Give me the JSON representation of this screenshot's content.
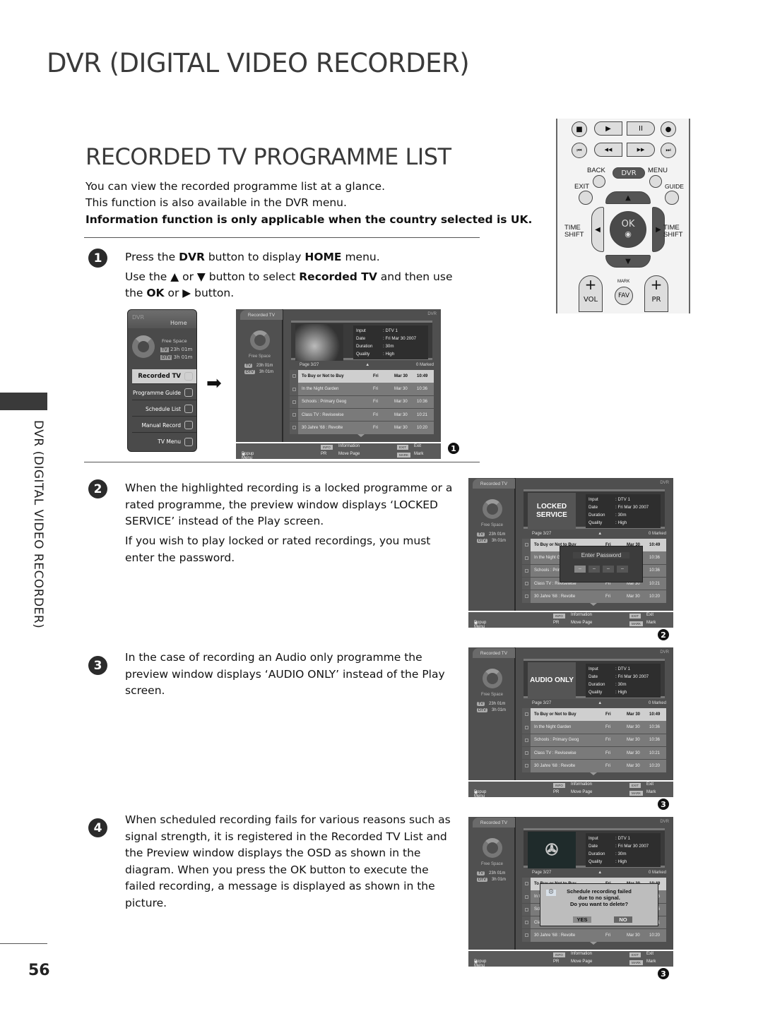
{
  "page": {
    "section_title": "DVR (DIGITAL VIDEO RECORDER)",
    "title": "RECORDED TV PROGRAMME LIST",
    "side_label": "DVR (DIGITAL VIDEO RECORDER)",
    "page_number": "56",
    "intro": [
      "You can view the recorded programme list at a glance.",
      "This function is also available in the DVR menu.",
      "Information function is only applicable when the country selected is UK."
    ]
  },
  "steps": [
    {
      "number": "1",
      "lines": {
        "a_pre": "Press the ",
        "a_b1": "DVR",
        "a_mid": " button to display ",
        "a_b2": "HOME",
        "a_post": " menu.",
        "b_pre": "Use the ▲ or ▼ button to select ",
        "b_b1": "Recorded TV",
        "b_post": " and then use",
        "c_pre": "the ",
        "c_b1": "OK",
        "c_post": " or ▶ button."
      }
    },
    {
      "number": "2",
      "text1": "When the highlighted recording is a locked programme or a rated programme, the preview window displays ‘LOCKED SERVICE’ instead of the Play screen.",
      "text2": "If you wish to play locked or rated recordings, you must enter the password."
    },
    {
      "number": "3",
      "text1": "In the case of recording an Audio only programme the preview window displays ‘AUDIO ONLY’ instead of the Play screen."
    },
    {
      "number": "4",
      "text1": "When scheduled recording fails for various reasons such as signal strength, it is registered in the Recorded TV List and the Preview window displays the OSD as shown in the diagram. When you press the OK button to execute the failed recording, a message is displayed as shown in the picture."
    }
  ],
  "remote": {
    "row1": [
      "■",
      "▶",
      "II",
      "●"
    ],
    "row2": [
      "⏮",
      "◀◀",
      "▶▶",
      "⏭"
    ],
    "back": "BACK",
    "dvr": "DVR",
    "menu": "MENU",
    "exit": "EXIT",
    "guide": "GUIDE",
    "time_shift_left": "TIME SHIFT",
    "time_shift_right": "TIME SHIFT",
    "ok": "OK",
    "mark": "MARK",
    "fav": "FAV",
    "vol": "VOL",
    "pr": "PR",
    "plus": "+"
  },
  "home_menu": {
    "logo": "DVR",
    "title": "Home",
    "free_space": "Free Space",
    "tv_badge": "TV",
    "tv_time": "23h 01m",
    "dtv_badge": "DTV",
    "dtv_time": "3h 01m",
    "items": [
      "Recorded TV",
      "Programme Guide",
      "Schedule List",
      "Manual Record",
      "TV Menu"
    ],
    "selected": "Recorded TV"
  },
  "recorded_tv": {
    "tab": "Recorded TV",
    "logo": "DVR",
    "free_space": "Free Space",
    "tv_badge": "TV",
    "tv_time": "23h 01m",
    "dtv_badge": "DTV",
    "dtv_time": "3h 01m",
    "info": [
      {
        "label": "Input",
        "value": ": DTV 1"
      },
      {
        "label": "Date",
        "value": ": Fri Mar 30 2007"
      },
      {
        "label": "Duration",
        "value": ": 30m"
      },
      {
        "label": "Quality",
        "value": ": High"
      }
    ],
    "page": "Page   3/27",
    "marked": "0 Marked",
    "rows": [
      {
        "title": "To Buy or Not to Buy",
        "day": "Fri",
        "date": "Mar 30",
        "time": "10:49"
      },
      {
        "title": "In the Night Garden",
        "day": "Fri",
        "date": "Mar 30",
        "time": "10:36"
      },
      {
        "title": "Schools : Primary Geog",
        "day": "Fri",
        "date": "Mar 30",
        "time": "10:36"
      },
      {
        "title": "Class TV : Revisewise",
        "day": "Fri",
        "date": "Mar 30",
        "time": "10:21"
      },
      {
        "title": "30 Jahre '68 : Revolte",
        "day": "Fri",
        "date": "Mar 30",
        "time": "10:20"
      }
    ],
    "footer": {
      "popup": "Popup Menu",
      "info_key": "INFO",
      "info": "Information",
      "pr_key": "PR",
      "move": "Move Page",
      "exit_key": "EXIT",
      "exit": "Exit",
      "mark_key": "MARK",
      "mark": "Mark"
    }
  },
  "screens": {
    "s1": {
      "preview": "",
      "callout": "1"
    },
    "s2": {
      "preview": "LOCKED SERVICE",
      "overlay_title": "Enter Password",
      "pin": [
        "–",
        "–",
        "–",
        "–"
      ],
      "callout": "2"
    },
    "s3": {
      "preview": "AUDIO ONLY",
      "callout": "3"
    },
    "s4": {
      "preview": "",
      "dialog_line1": "Schedule recording failed",
      "dialog_line2": "due to no signal.",
      "dialog_line3": "Do you want to delete?",
      "yes": "YES",
      "no": "NO",
      "callout": "3"
    }
  }
}
